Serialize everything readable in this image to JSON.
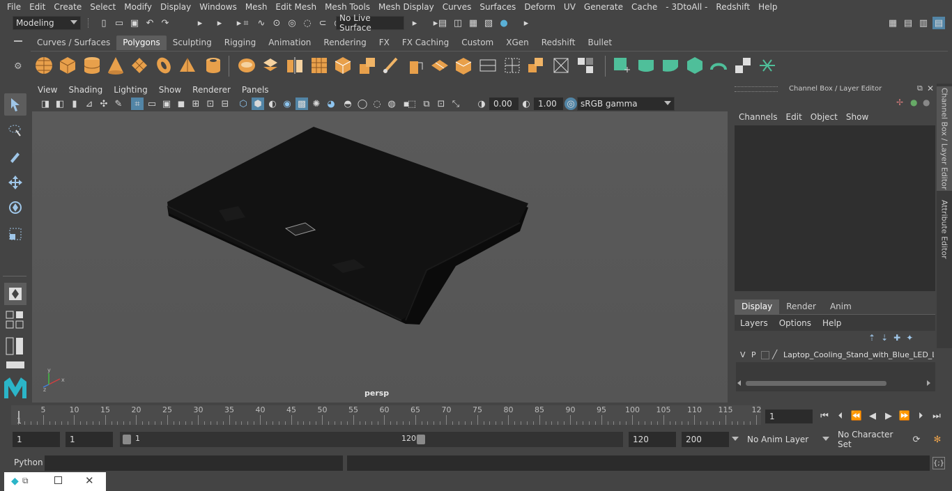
{
  "menubar": [
    "File",
    "Edit",
    "Create",
    "Select",
    "Modify",
    "Display",
    "Windows",
    "Mesh",
    "Edit Mesh",
    "Mesh Tools",
    "Mesh Display",
    "Curves",
    "Surfaces",
    "Deform",
    "UV",
    "Generate",
    "Cache",
    "- 3DtoAll -",
    "Redshift",
    "Help"
  ],
  "statusline": {
    "mode": "Modeling",
    "live_surface": "No Live Surface"
  },
  "shelf": {
    "tabs": [
      "Curves / Surfaces",
      "Polygons",
      "Sculpting",
      "Rigging",
      "Animation",
      "Rendering",
      "FX",
      "FX Caching",
      "Custom",
      "XGen",
      "Redshift",
      "Bullet"
    ],
    "active_tab": "Polygons"
  },
  "viewport": {
    "menu": [
      "View",
      "Shading",
      "Lighting",
      "Show",
      "Renderer",
      "Panels"
    ],
    "exposure": "0.00",
    "gamma": "1.00",
    "color_space": "sRGB gamma",
    "camera_label": "persp"
  },
  "channelbox": {
    "title": "Channel Box / Layer Editor",
    "menu": [
      "Channels",
      "Edit",
      "Object",
      "Show"
    ],
    "layer_tabs": [
      "Display",
      "Render",
      "Anim"
    ],
    "active_layer_tab": "Display",
    "layer_menu": [
      "Layers",
      "Options",
      "Help"
    ],
    "layer": {
      "v": "V",
      "p": "P",
      "name": "Laptop_Cooling_Stand_with_Blue_LED_Lig"
    }
  },
  "side_tabs": {
    "channel_box": "Channel Box / Layer Editor",
    "attribute_editor": "Attribute Editor"
  },
  "timeline": {
    "ticks": [
      "5",
      "10",
      "15",
      "20",
      "25",
      "30",
      "35",
      "40",
      "45",
      "50",
      "55",
      "60",
      "65",
      "70",
      "75",
      "80",
      "85",
      "90",
      "95",
      "100",
      "105",
      "110",
      "115",
      "12"
    ],
    "start_marker": "1",
    "current_frame": "1"
  },
  "range": {
    "start": "1",
    "playback_start": "1",
    "slider_start": "1",
    "slider_end": "120",
    "playback_end": "120",
    "end": "200",
    "anim_layer": "No Anim Layer",
    "character_set": "No Character Set"
  },
  "cmdline": {
    "label": "Python"
  },
  "colors": {
    "accent_blue": "#5285a6",
    "shelf_orange": "#e8a04b",
    "shelf_green": "#4fbf9a"
  }
}
